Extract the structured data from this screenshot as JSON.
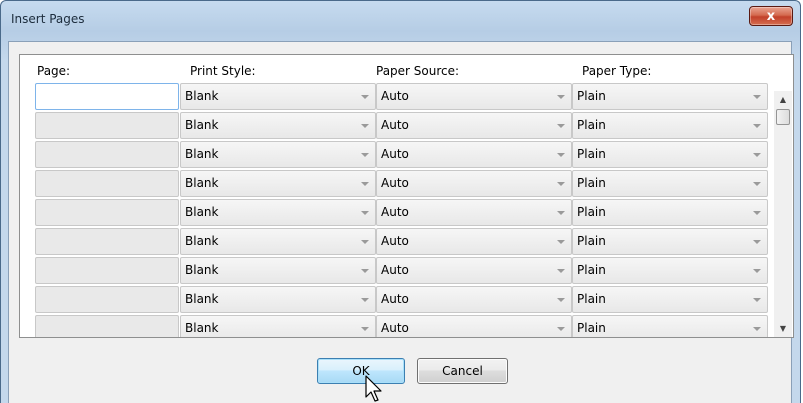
{
  "window": {
    "title": "Insert Pages",
    "close_label": "x"
  },
  "columns": {
    "page": "Page:",
    "print_style": "Print Style:",
    "paper_source": "Paper Source:",
    "paper_type": "Paper Type:"
  },
  "rows": [
    {
      "page": "",
      "print_style": "Blank",
      "paper_source": "Auto",
      "paper_type": "Plain"
    },
    {
      "page": "",
      "print_style": "Blank",
      "paper_source": "Auto",
      "paper_type": "Plain"
    },
    {
      "page": "",
      "print_style": "Blank",
      "paper_source": "Auto",
      "paper_type": "Plain"
    },
    {
      "page": "",
      "print_style": "Blank",
      "paper_source": "Auto",
      "paper_type": "Plain"
    },
    {
      "page": "",
      "print_style": "Blank",
      "paper_source": "Auto",
      "paper_type": "Plain"
    },
    {
      "page": "",
      "print_style": "Blank",
      "paper_source": "Auto",
      "paper_type": "Plain"
    },
    {
      "page": "",
      "print_style": "Blank",
      "paper_source": "Auto",
      "paper_type": "Plain"
    },
    {
      "page": "",
      "print_style": "Blank",
      "paper_source": "Auto",
      "paper_type": "Plain"
    },
    {
      "page": "",
      "print_style": "Blank",
      "paper_source": "Auto",
      "paper_type": "Plain"
    }
  ],
  "buttons": {
    "ok": "OK",
    "cancel": "Cancel"
  },
  "icons": {
    "close": "close-icon",
    "scroll_up": "scroll-up-arrow-icon",
    "scroll_down": "scroll-down-arrow-icon",
    "cursor": "mouse-pointer-icon"
  }
}
